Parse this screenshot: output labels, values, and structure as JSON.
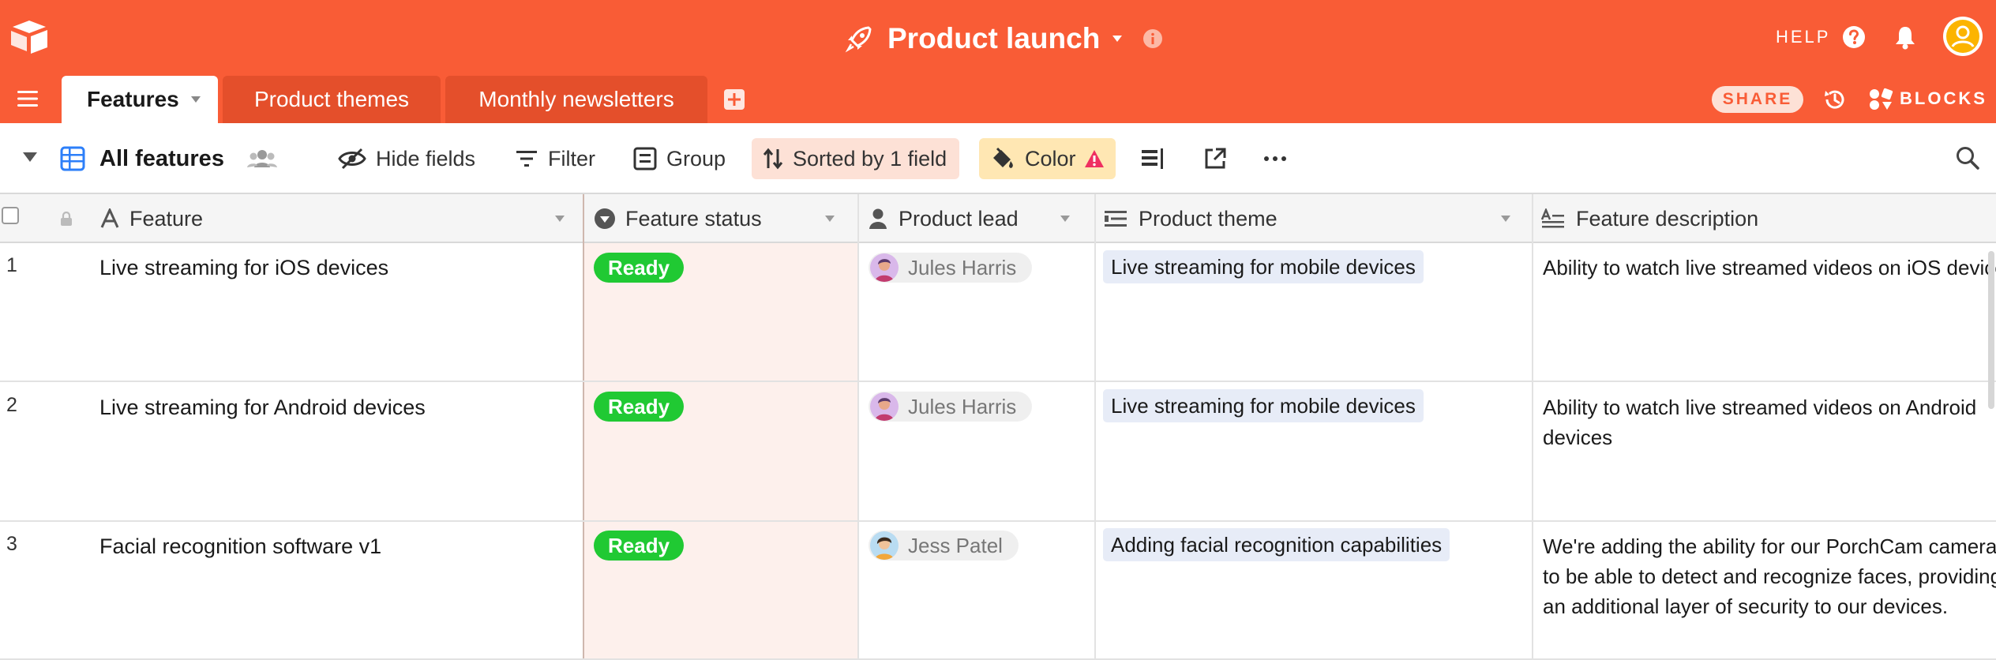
{
  "base": {
    "title": "Product launch"
  },
  "header": {
    "help_label": "HELP"
  },
  "tabs": [
    {
      "label": "Features",
      "active": true
    },
    {
      "label": "Product themes",
      "active": false
    },
    {
      "label": "Monthly newsletters",
      "active": false
    }
  ],
  "tabbar_right": {
    "share_label": "SHARE",
    "blocks_label": "BLOCKS"
  },
  "view": {
    "name": "All features",
    "hide_fields_label": "Hide fields",
    "filter_label": "Filter",
    "group_label": "Group",
    "sort_label": "Sorted by 1 field",
    "color_label": "Color"
  },
  "columns": [
    {
      "label": "Feature",
      "icon": "text-field-icon"
    },
    {
      "label": "Feature status",
      "icon": "single-select-icon"
    },
    {
      "label": "Product lead",
      "icon": "collaborator-icon"
    },
    {
      "label": "Product theme",
      "icon": "link-field-icon"
    },
    {
      "label": "Feature description",
      "icon": "long-text-icon"
    }
  ],
  "rows": [
    {
      "num": "1",
      "feature": "Live streaming for iOS devices",
      "status": "Ready",
      "lead": "Jules Harris",
      "theme": "Live streaming for mobile devices",
      "description": "Ability to watch live streamed videos on iOS devices"
    },
    {
      "num": "2",
      "feature": "Live streaming for Android devices",
      "status": "Ready",
      "lead": "Jules Harris",
      "theme": "Live streaming for mobile devices",
      "description": "Ability to watch live streamed videos on Android devices"
    },
    {
      "num": "3",
      "feature": "Facial recognition software v1",
      "status": "Ready",
      "lead": "Jess Patel",
      "theme": "Adding facial recognition capabilities",
      "description": "We're adding the ability for our PorchCam cameras to be able to detect and recognize faces, providing an additional layer of security to our devices."
    }
  ],
  "colors": {
    "brand": "#f95c36",
    "tab_inactive": "#e44f2b",
    "ready": "#20c933",
    "sort_highlight": "#fde1d6",
    "color_highlight": "#ffe7b3",
    "theme_pill": "#e7ecf7"
  }
}
